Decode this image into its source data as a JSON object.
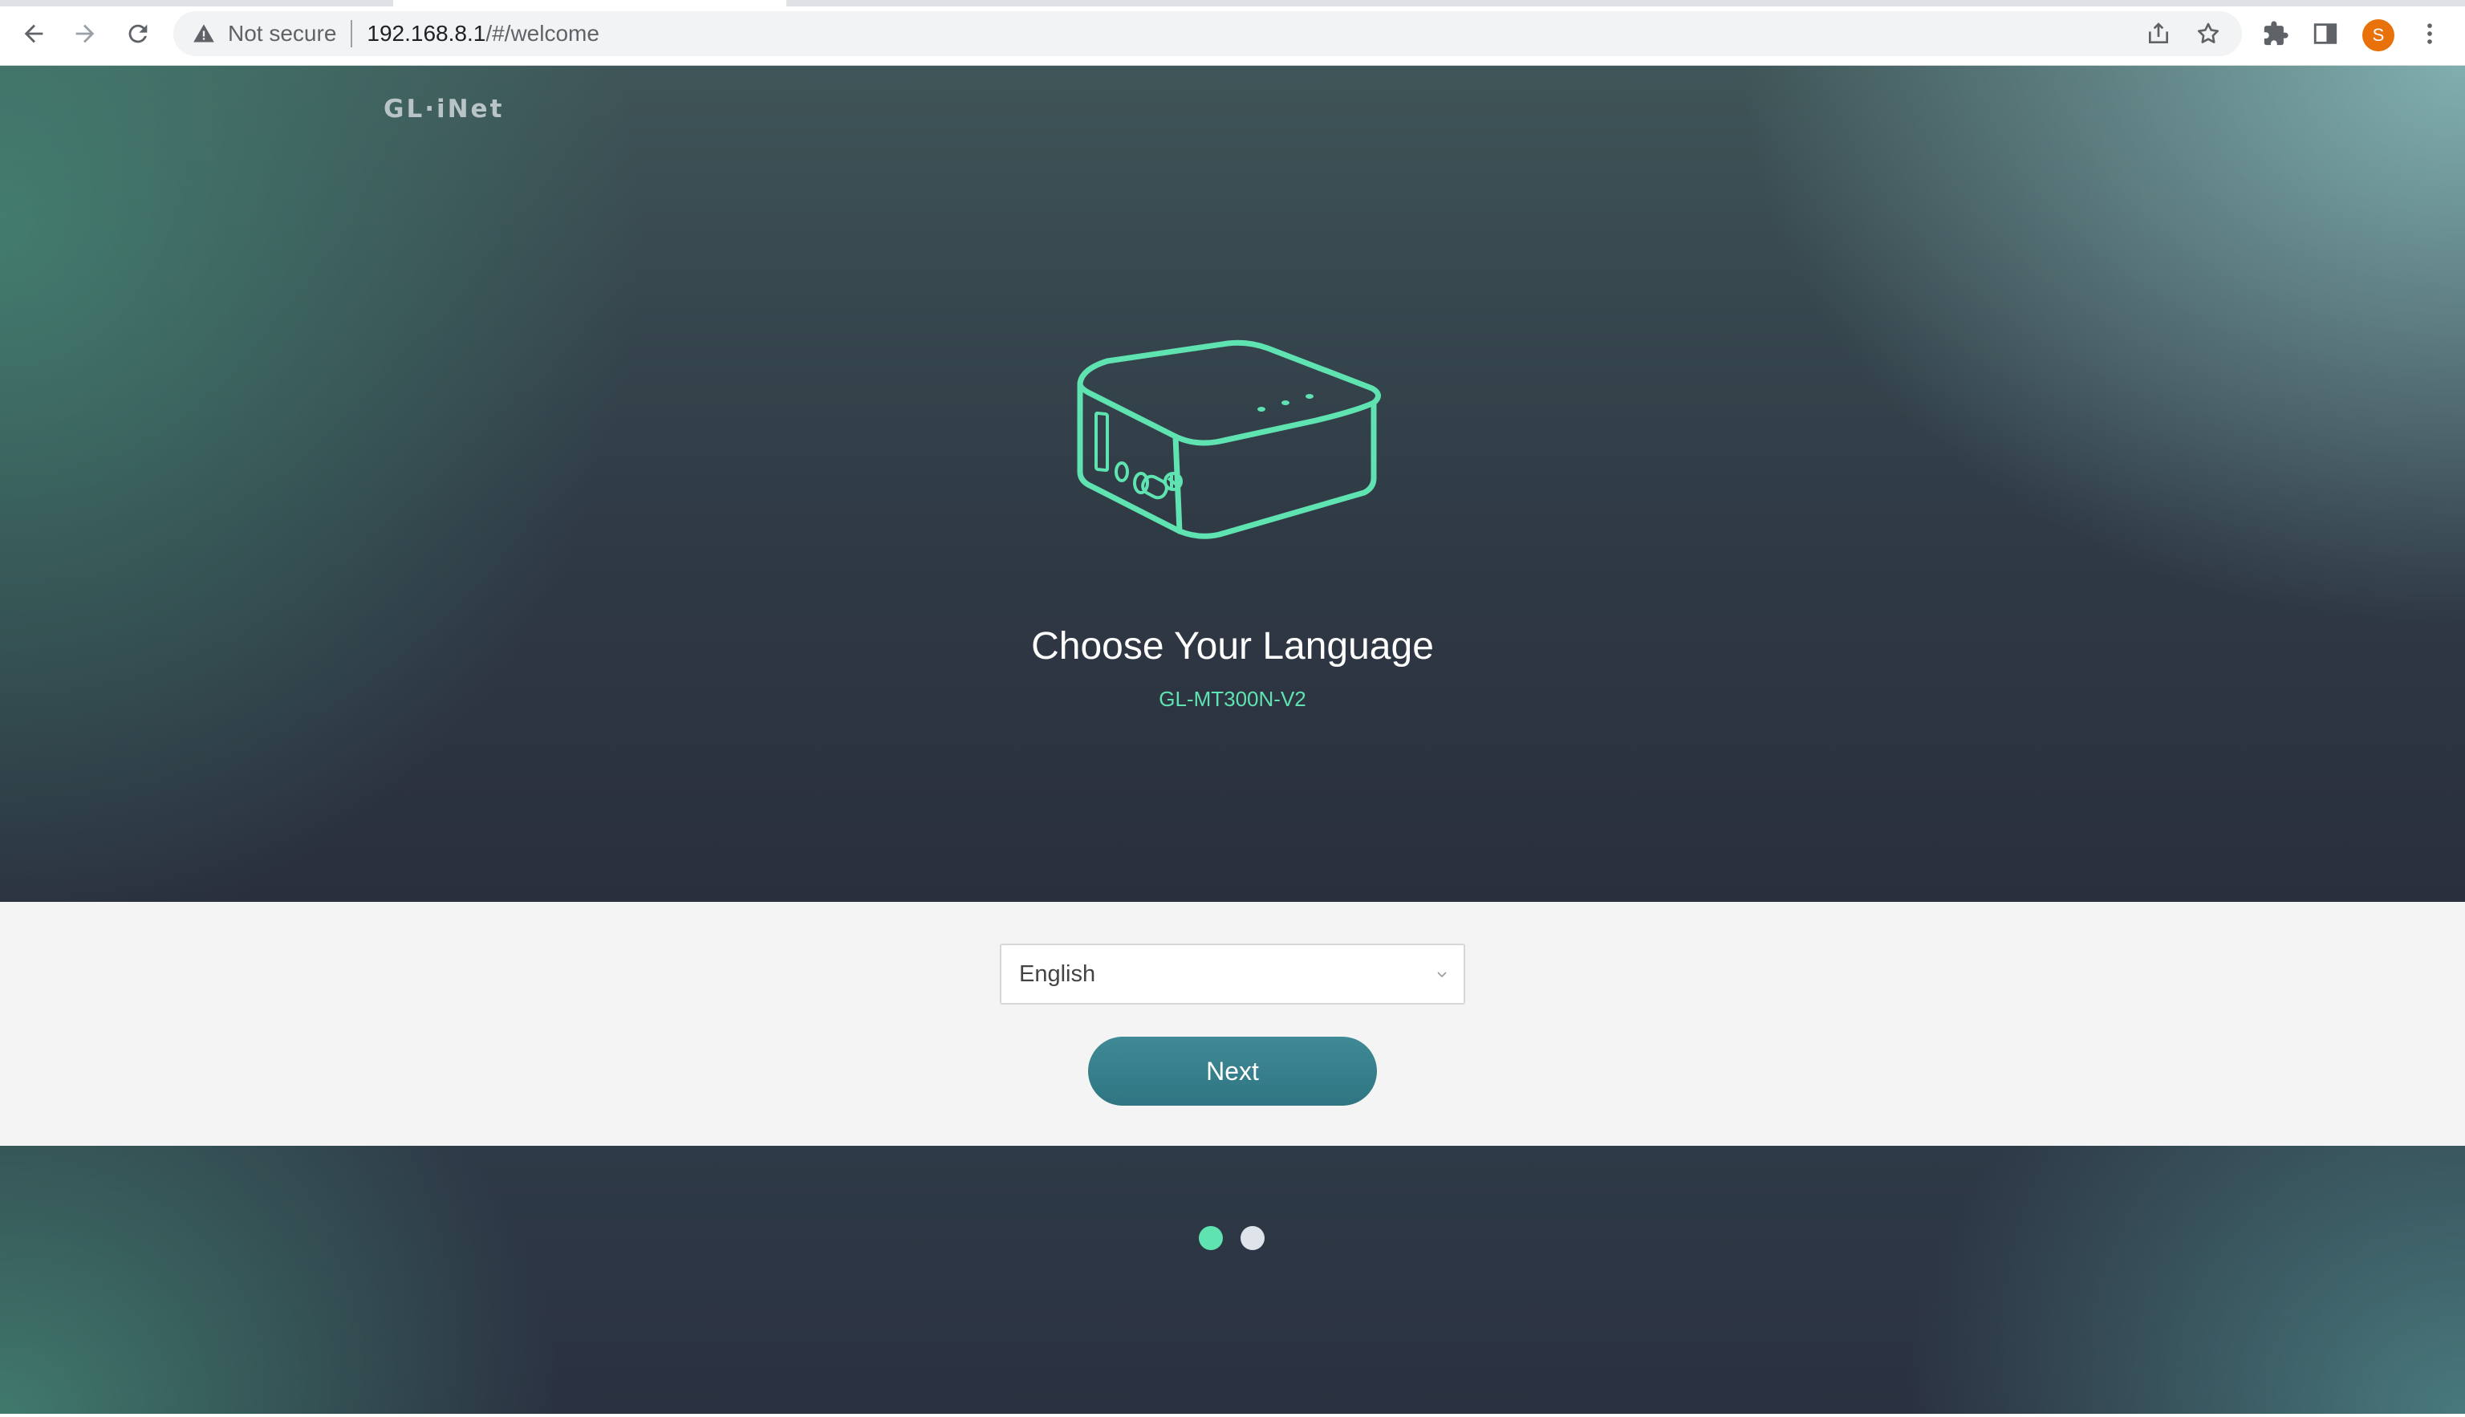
{
  "browser": {
    "security_label": "Not secure",
    "url_host": "192.168.8.1",
    "url_path": "/#/welcome",
    "profile_initial": "S",
    "icons": [
      "back-icon",
      "forward-icon",
      "reload-icon",
      "warning-icon",
      "share-icon",
      "star-icon",
      "extensions-icon",
      "side-panel-icon",
      "menu-icon"
    ]
  },
  "page": {
    "logo": "GL·iNet",
    "title": "Choose Your Language",
    "model": "GL-MT300N-V2",
    "language_select": {
      "value": "English"
    },
    "next_button": "Next",
    "pager": {
      "total": 2,
      "active_index": 0
    }
  },
  "colors": {
    "accent": "#5fe3b1",
    "button": "#3a8390",
    "panel_bg": "#f4f4f4",
    "avatar": "#e8710a"
  }
}
